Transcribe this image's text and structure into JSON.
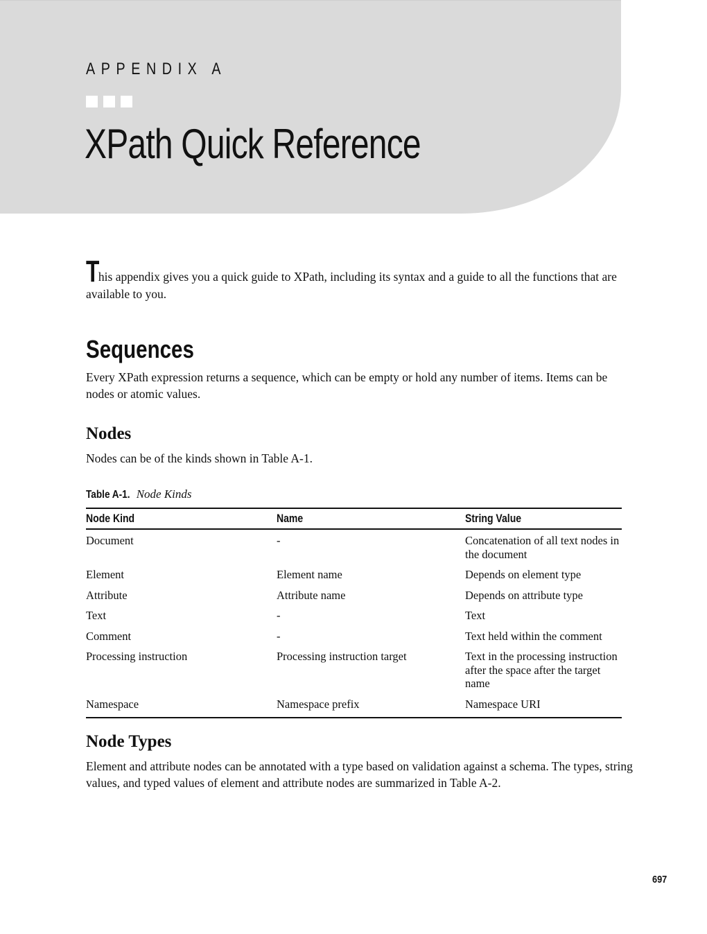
{
  "chapter": {
    "label": "APPENDIX A",
    "ornament": "square-bullets-icon",
    "title": "XPath Quick Reference"
  },
  "intro": {
    "dropcap": "T",
    "text": "his appendix gives you a quick guide to XPath, including its syntax and a guide to all the functions that are available to you."
  },
  "sections": {
    "sequences": {
      "heading": "Sequences",
      "body": "Every XPath expression returns a sequence, which can be empty or hold any number of items. Items can be nodes or atomic values."
    },
    "nodes": {
      "heading": "Nodes",
      "body": "Nodes can be of the kinds shown in Table A-1."
    },
    "node_types": {
      "heading": "Node Types",
      "body": "Element and attribute nodes can be annotated with a type based on validation against a schema. The types, string values, and typed values of element and attribute nodes are summarized in Table A-2."
    }
  },
  "table": {
    "caption_label": "Table A-1.",
    "caption_title": "Node Kinds",
    "headers": [
      "Node Kind",
      "Name",
      "String Value"
    ],
    "rows": [
      [
        "Document",
        "-",
        "Concatenation of all text nodes in the document"
      ],
      [
        "Element",
        "Element name",
        "Depends on element type"
      ],
      [
        "Attribute",
        "Attribute name",
        "Depends on attribute type"
      ],
      [
        "Text",
        "-",
        "Text"
      ],
      [
        "Comment",
        "-",
        "Text held within the comment"
      ],
      [
        "Processing instruction",
        "Processing instruction target",
        "Text in the processing instruction after the space after the target name"
      ],
      [
        "Namespace",
        "Namespace prefix",
        "Namespace URI"
      ]
    ]
  },
  "footer": {
    "page_number": "697"
  }
}
